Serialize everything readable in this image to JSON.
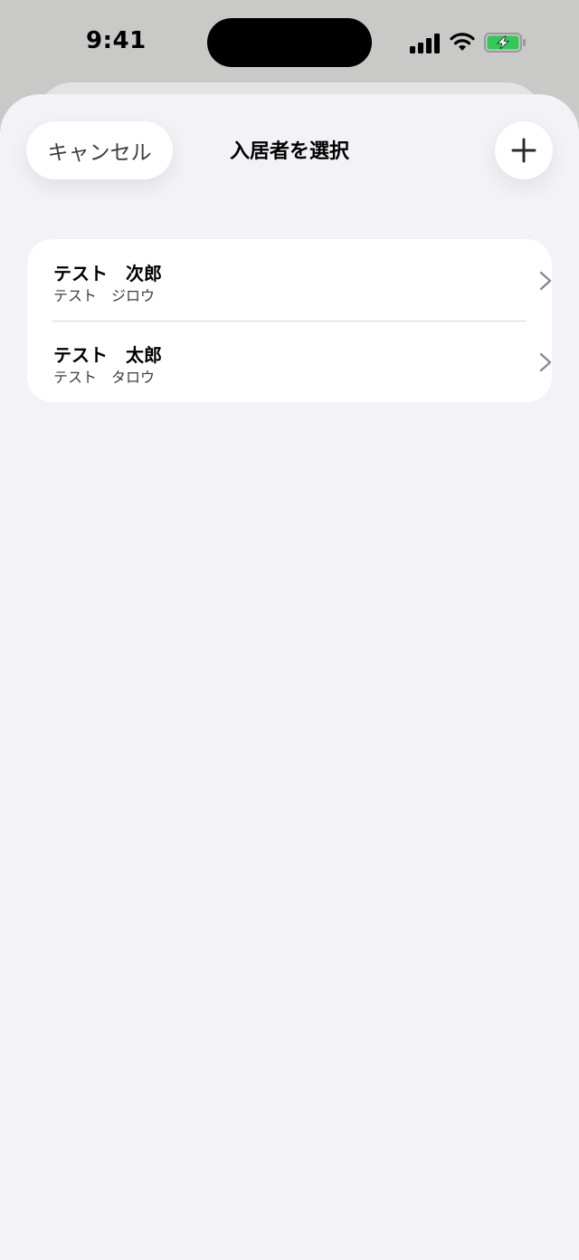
{
  "status_bar": {
    "time": "9:41",
    "signal_icon": "cellular-signal-icon",
    "wifi_icon": "wifi-icon",
    "battery_icon": "battery-charging-icon",
    "battery_color": "#34c759"
  },
  "sheet": {
    "cancel_label": "キャンセル",
    "title": "入居者を選択",
    "add_icon": "plus-icon"
  },
  "residents": [
    {
      "name": "テスト　次郎",
      "kana": "テスト　ジロウ"
    },
    {
      "name": "テスト　太郎",
      "kana": "テスト　タロウ"
    }
  ]
}
